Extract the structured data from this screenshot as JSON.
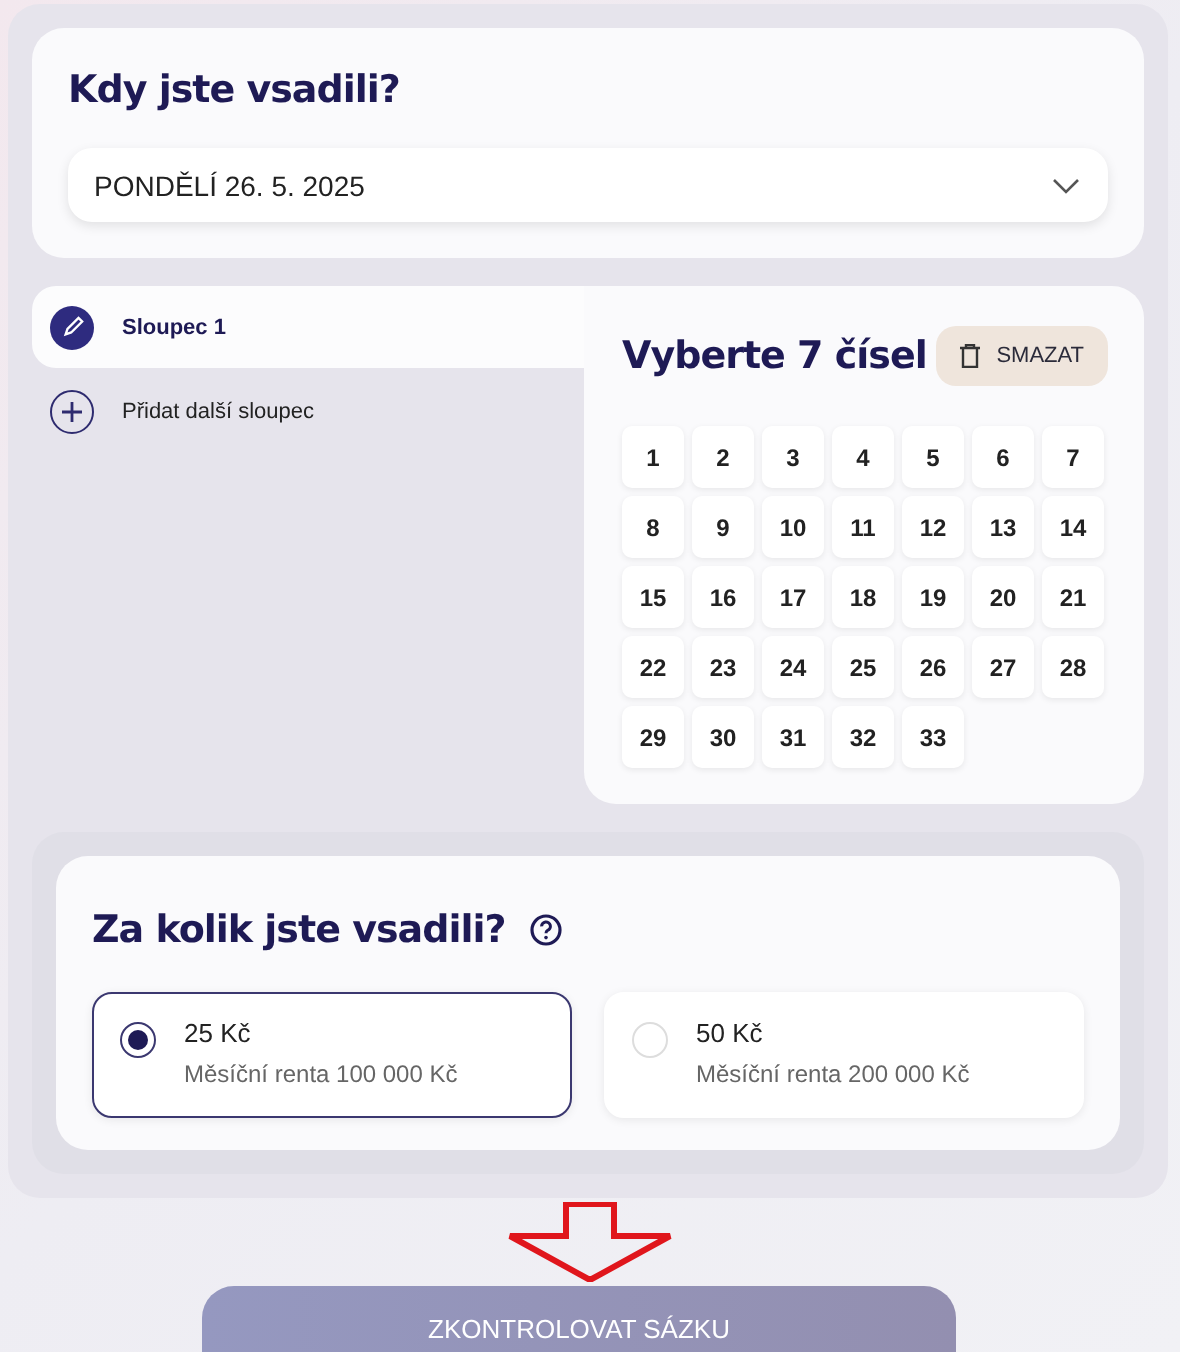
{
  "date_section": {
    "title": "Kdy jste vsadili?",
    "date_select": {
      "value": "PONDĚLÍ 26. 5. 2025"
    }
  },
  "columns": [
    {
      "label": "Sloupec 1",
      "selected": true
    }
  ],
  "add_column": {
    "label": "Přidat další sloupec"
  },
  "number_picker": {
    "title": "Vyberte 7 čísel",
    "clear_button": "SMAZAT",
    "numbers": [
      {
        "label": "1",
        "selected": false
      },
      {
        "label": "2",
        "selected": false
      },
      {
        "label": "3",
        "selected": false
      },
      {
        "label": "4",
        "selected": false
      },
      {
        "label": "5",
        "selected": false
      },
      {
        "label": "6",
        "selected": false
      },
      {
        "label": "7",
        "selected": false
      },
      {
        "label": "8",
        "selected": false
      },
      {
        "label": "9",
        "selected": false
      },
      {
        "label": "10",
        "selected": false
      },
      {
        "label": "11",
        "selected": false
      },
      {
        "label": "12",
        "selected": false
      },
      {
        "label": "13",
        "selected": false
      },
      {
        "label": "14",
        "selected": false
      },
      {
        "label": "15",
        "selected": false
      },
      {
        "label": "16",
        "selected": false
      },
      {
        "label": "17",
        "selected": false
      },
      {
        "label": "18",
        "selected": false
      },
      {
        "label": "19",
        "selected": false
      },
      {
        "label": "20",
        "selected": false
      },
      {
        "label": "21",
        "selected": false
      },
      {
        "label": "22",
        "selected": false
      },
      {
        "label": "23",
        "selected": false
      },
      {
        "label": "24",
        "selected": false
      },
      {
        "label": "25",
        "selected": false
      },
      {
        "label": "26",
        "selected": false
      },
      {
        "label": "27",
        "selected": false
      },
      {
        "label": "28",
        "selected": false
      },
      {
        "label": "29",
        "selected": false
      },
      {
        "label": "30",
        "selected": false
      },
      {
        "label": "31",
        "selected": false
      },
      {
        "label": "32",
        "selected": false
      },
      {
        "label": "33",
        "selected": false
      }
    ]
  },
  "stake_section": {
    "title": "Za kolik jste vsadili?",
    "options": [
      {
        "amount": "25 Kč",
        "description": "Měsíční renta 100 000 Kč",
        "selected": true
      },
      {
        "amount": "50 Kč",
        "description": "Měsíční renta 200 000 Kč",
        "selected": false
      }
    ]
  },
  "submit_button": "ZKONTROLOVAT SÁZKU"
}
